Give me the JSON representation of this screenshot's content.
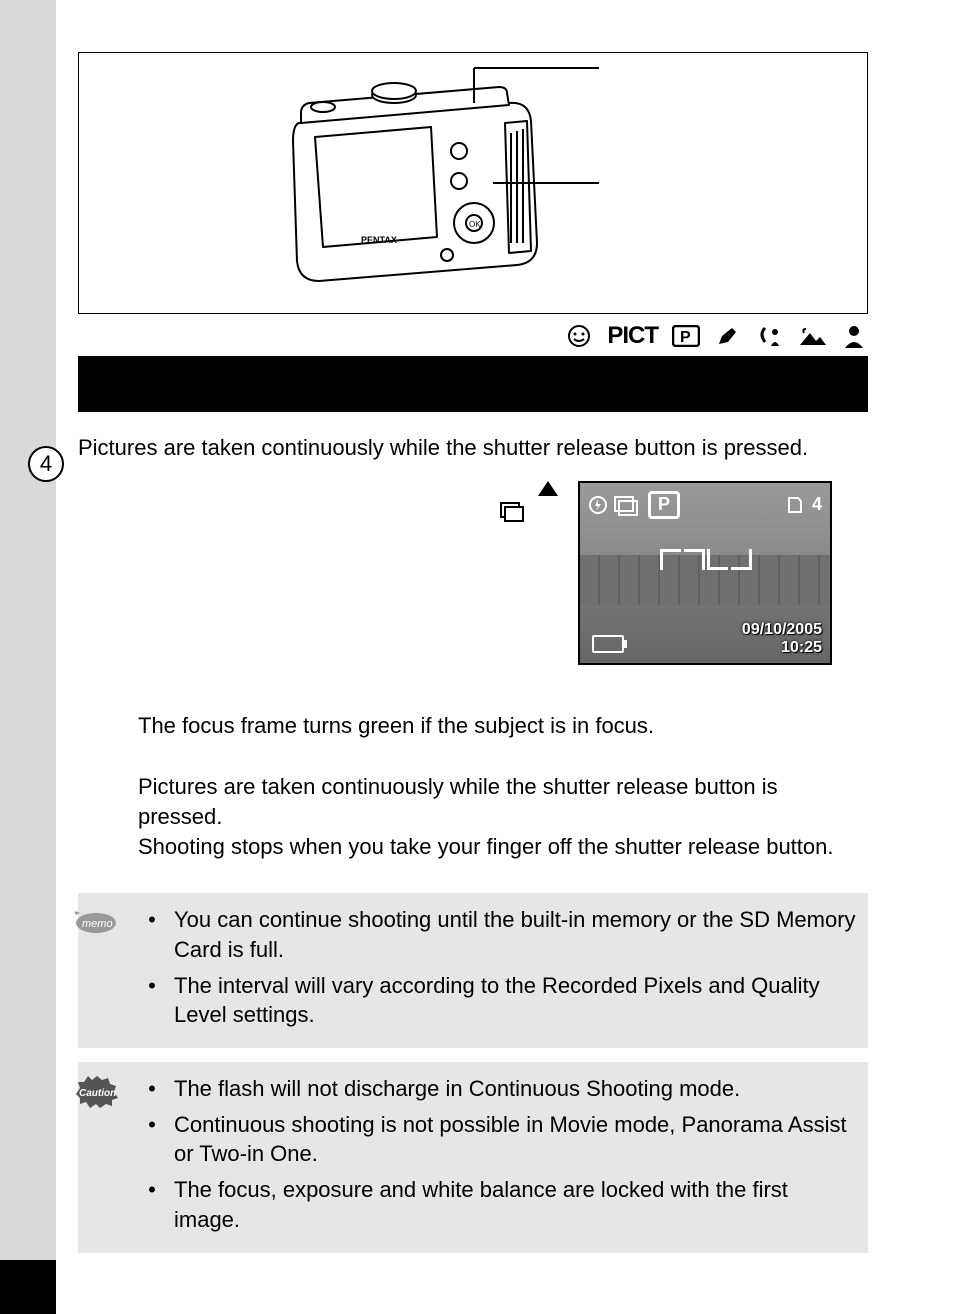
{
  "section_number": "4",
  "modes": {
    "pict_label": "PICT"
  },
  "intro_text": "Pictures are taken continuously while the shutter release button is pressed.",
  "lcd": {
    "mode_letter": "P",
    "shots_remaining": "4",
    "date": "09/10/2005",
    "time": "10:25"
  },
  "step2_text": "The focus frame turns green if the subject is in focus.",
  "step3_text_a": "Pictures are taken continuously while the shutter release button is pressed.",
  "step3_text_b": "Shooting stops when you take your finger off the shutter release button.",
  "memo_label": "memo",
  "memo_items": [
    "You can continue shooting until the built-in memory or the SD Memory Card is full.",
    "The interval will vary according to the Recorded Pixels and Quality Level settings."
  ],
  "caution_label": "Caution",
  "caution_items": [
    "The flash will not discharge in Continuous Shooting mode.",
    "Continuous shooting is not possible in Movie mode, Panorama Assist or Two-in One.",
    "The focus, exposure and white balance are locked with the first image."
  ]
}
